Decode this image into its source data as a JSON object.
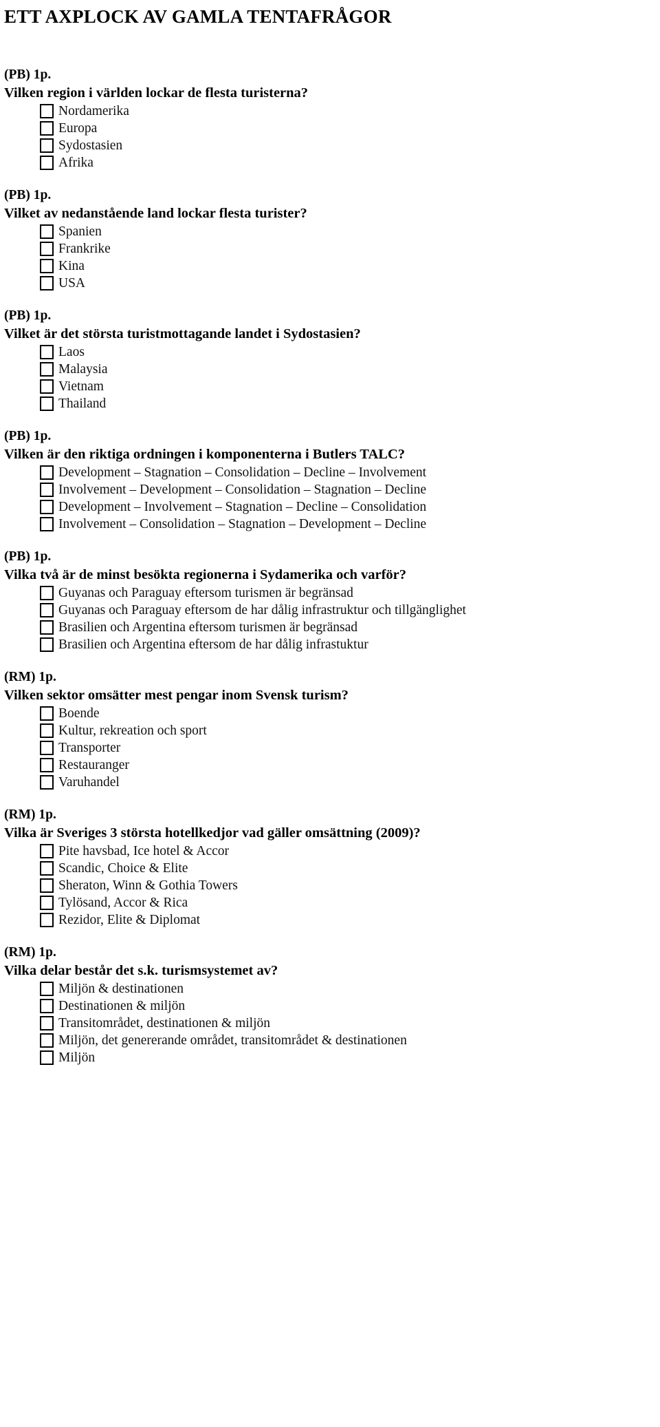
{
  "document": {
    "title": "ETT AXPLOCK AV GAMLA TENTAFRÅGOR"
  },
  "questions": [
    {
      "points": "(PB) 1p.",
      "text": "Vilken region i världen lockar de flesta turisterna?",
      "options": [
        "Nordamerika",
        "Europa",
        "Sydostasien",
        "Afrika"
      ]
    },
    {
      "points": "(PB) 1p.",
      "text": "Vilket av nedanstående land lockar flesta turister?",
      "options": [
        "Spanien",
        "Frankrike",
        "Kina",
        "USA"
      ]
    },
    {
      "points": "(PB) 1p.",
      "text": "Vilket är det största turistmottagande landet i Sydostasien?",
      "options": [
        "Laos",
        "Malaysia",
        "Vietnam",
        "Thailand"
      ]
    },
    {
      "points": "(PB) 1p.",
      "text": "Vilken är den riktiga ordningen i komponenterna i Butlers TALC?",
      "options": [
        "Development – Stagnation – Consolidation – Decline – Involvement",
        "Involvement – Development – Consolidation – Stagnation – Decline",
        "Development – Involvement – Stagnation – Decline – Consolidation",
        "Involvement – Consolidation – Stagnation – Development – Decline"
      ]
    },
    {
      "points": "(PB) 1p.",
      "text": "Vilka två är de minst besökta regionerna i Sydamerika och varför?",
      "options": [
        "Guyanas och Paraguay eftersom turismen är begränsad",
        "Guyanas och Paraguay eftersom de har dålig infrastruktur och tillgänglighet",
        "Brasilien och Argentina eftersom turismen är begränsad",
        "Brasilien och Argentina eftersom de har dålig infrastuktur"
      ]
    },
    {
      "points": "(RM) 1p.",
      "text": "Vilken sektor omsätter mest pengar inom Svensk turism?",
      "options": [
        "Boende",
        "Kultur, rekreation och sport",
        "Transporter",
        "Restauranger",
        "Varuhandel"
      ]
    },
    {
      "points": "(RM) 1p.",
      "text": "Vilka är Sveriges 3 största hotellkedjor vad gäller omsättning (2009)?",
      "options": [
        "Pite havsbad, Ice hotel & Accor",
        "Scandic, Choice & Elite",
        "Sheraton, Winn & Gothia Towers",
        "Tylösand, Accor & Rica",
        "Rezidor, Elite & Diplomat"
      ]
    },
    {
      "points": "(RM) 1p.",
      "text": "Vilka delar består det s.k. turismsystemet av?",
      "options": [
        "Miljön & destinationen",
        "Destinationen & miljön",
        "Transitområdet, destinationen & miljön",
        "Miljön, det genererande området, transitområdet & destinationen",
        "Miljön"
      ]
    }
  ]
}
